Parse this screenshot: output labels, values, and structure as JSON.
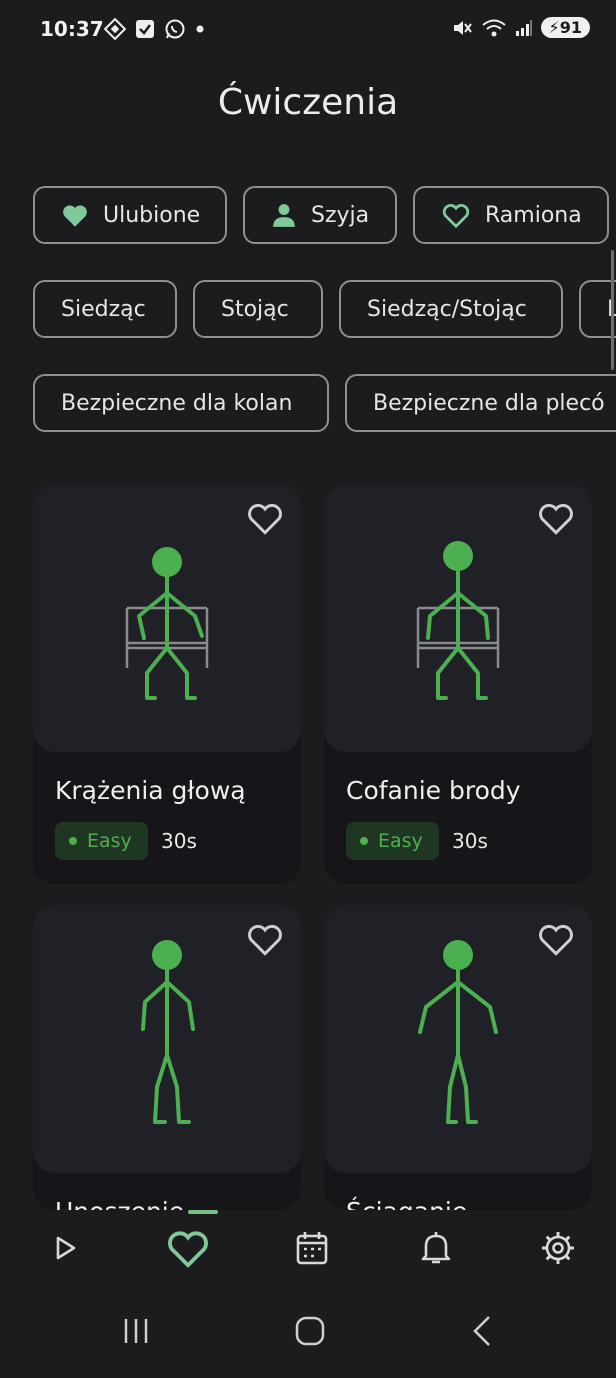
{
  "status_bar": {
    "time": "10:37",
    "battery": "91"
  },
  "page": {
    "title": "Ćwiczenia"
  },
  "filters": {
    "categories": [
      "Ulubione",
      "Szyja",
      "Ramiona"
    ],
    "positions": [
      "Siedząc",
      "Stojąc",
      "Siedząc/Stojąc",
      "L"
    ],
    "safety": [
      "Bezpieczne dla kolan",
      "Bezpieczne dla plecó"
    ]
  },
  "exercises": [
    {
      "title": "Krążenia głową",
      "difficulty": "Easy",
      "duration": "30s",
      "pose": "seated"
    },
    {
      "title": "Cofanie brody",
      "difficulty": "Easy",
      "duration": "30s",
      "pose": "seated"
    },
    {
      "title": "Unoszenie…",
      "difficulty": "",
      "duration": "",
      "pose": "standing"
    },
    {
      "title": "Ściąganie…",
      "difficulty": "",
      "duration": "",
      "pose": "standing"
    }
  ],
  "bottom_nav": {
    "items": [
      "play",
      "favorites",
      "calendar",
      "notifications",
      "settings"
    ],
    "active": "favorites"
  },
  "colors": {
    "background": "#1c1c1e",
    "card": "#202127",
    "accent_green": "#4caf50",
    "chip_icon_green": "#7fc99a"
  }
}
